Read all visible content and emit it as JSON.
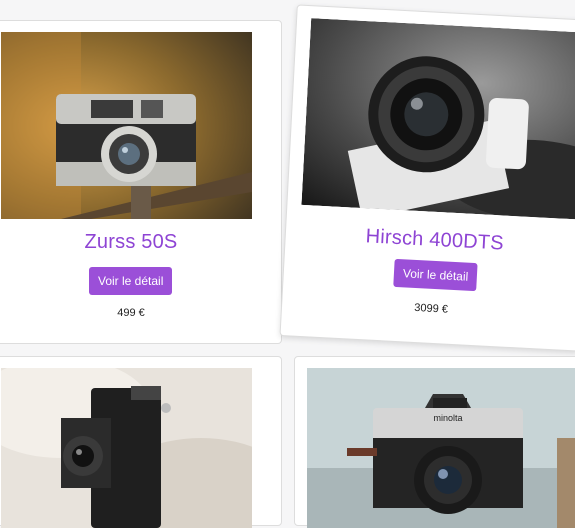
{
  "products": [
    {
      "name": "Zurss 50S",
      "button_label": "Voir le détail",
      "price": "499 €",
      "image_icon": "rangefinder-camera-photo"
    },
    {
      "name": "Hirsch 400DTS",
      "button_label": "Voir le détail",
      "price": "3099 €",
      "image_icon": "black-white-camera-lens-photo"
    },
    {
      "name": "",
      "button_label": "",
      "price": "",
      "image_icon": "vintage-folding-camera-photo"
    },
    {
      "name": "",
      "button_label": "",
      "price": "",
      "image_icon": "minolta-slr-camera-photo"
    }
  ],
  "brand": {
    "camera_badge": "minolta"
  },
  "colors": {
    "accent": "#9b4fd8",
    "title": "#8e44d4"
  }
}
